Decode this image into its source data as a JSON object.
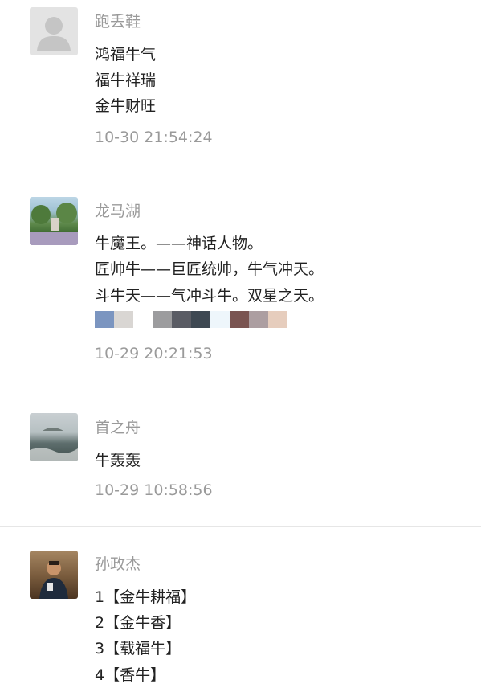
{
  "comments": [
    {
      "name": "跑丢鞋",
      "avatar": "default-user-avatar",
      "lines": [
        "鸿福牛气",
        "福牛祥瑞",
        "金牛财旺"
      ],
      "time": "10-30 21:54:24"
    },
    {
      "name": "龙马湖",
      "avatar": "lakeside-photo-avatar",
      "lines": [
        "牛魔王。——神话人物。",
        "匠帅牛——巨匠统帅，牛气冲天。",
        "斗牛天——气冲斗牛。双星之天。"
      ],
      "time": "10-29 20:21:53"
    },
    {
      "name": "首之舟",
      "avatar": "sea-photo-avatar",
      "lines": [
        "牛轰轰"
      ],
      "time": "10-29 10:58:56"
    },
    {
      "name": "孙政杰",
      "avatar": "portrait-photo-avatar",
      "lines": [
        "1【金牛耕福】",
        "2【金牛香】",
        "3【载福牛】",
        "4【香牛】"
      ],
      "time": ""
    }
  ],
  "emoji_colors": [
    "#7b95c0",
    "#d9d6d3",
    "#ffffff",
    "#9c9c9e",
    "#5a5c64",
    "#3e4852",
    "#eef6fb",
    "#7a5451",
    "#ac9ea1",
    "#e6cdbd"
  ]
}
